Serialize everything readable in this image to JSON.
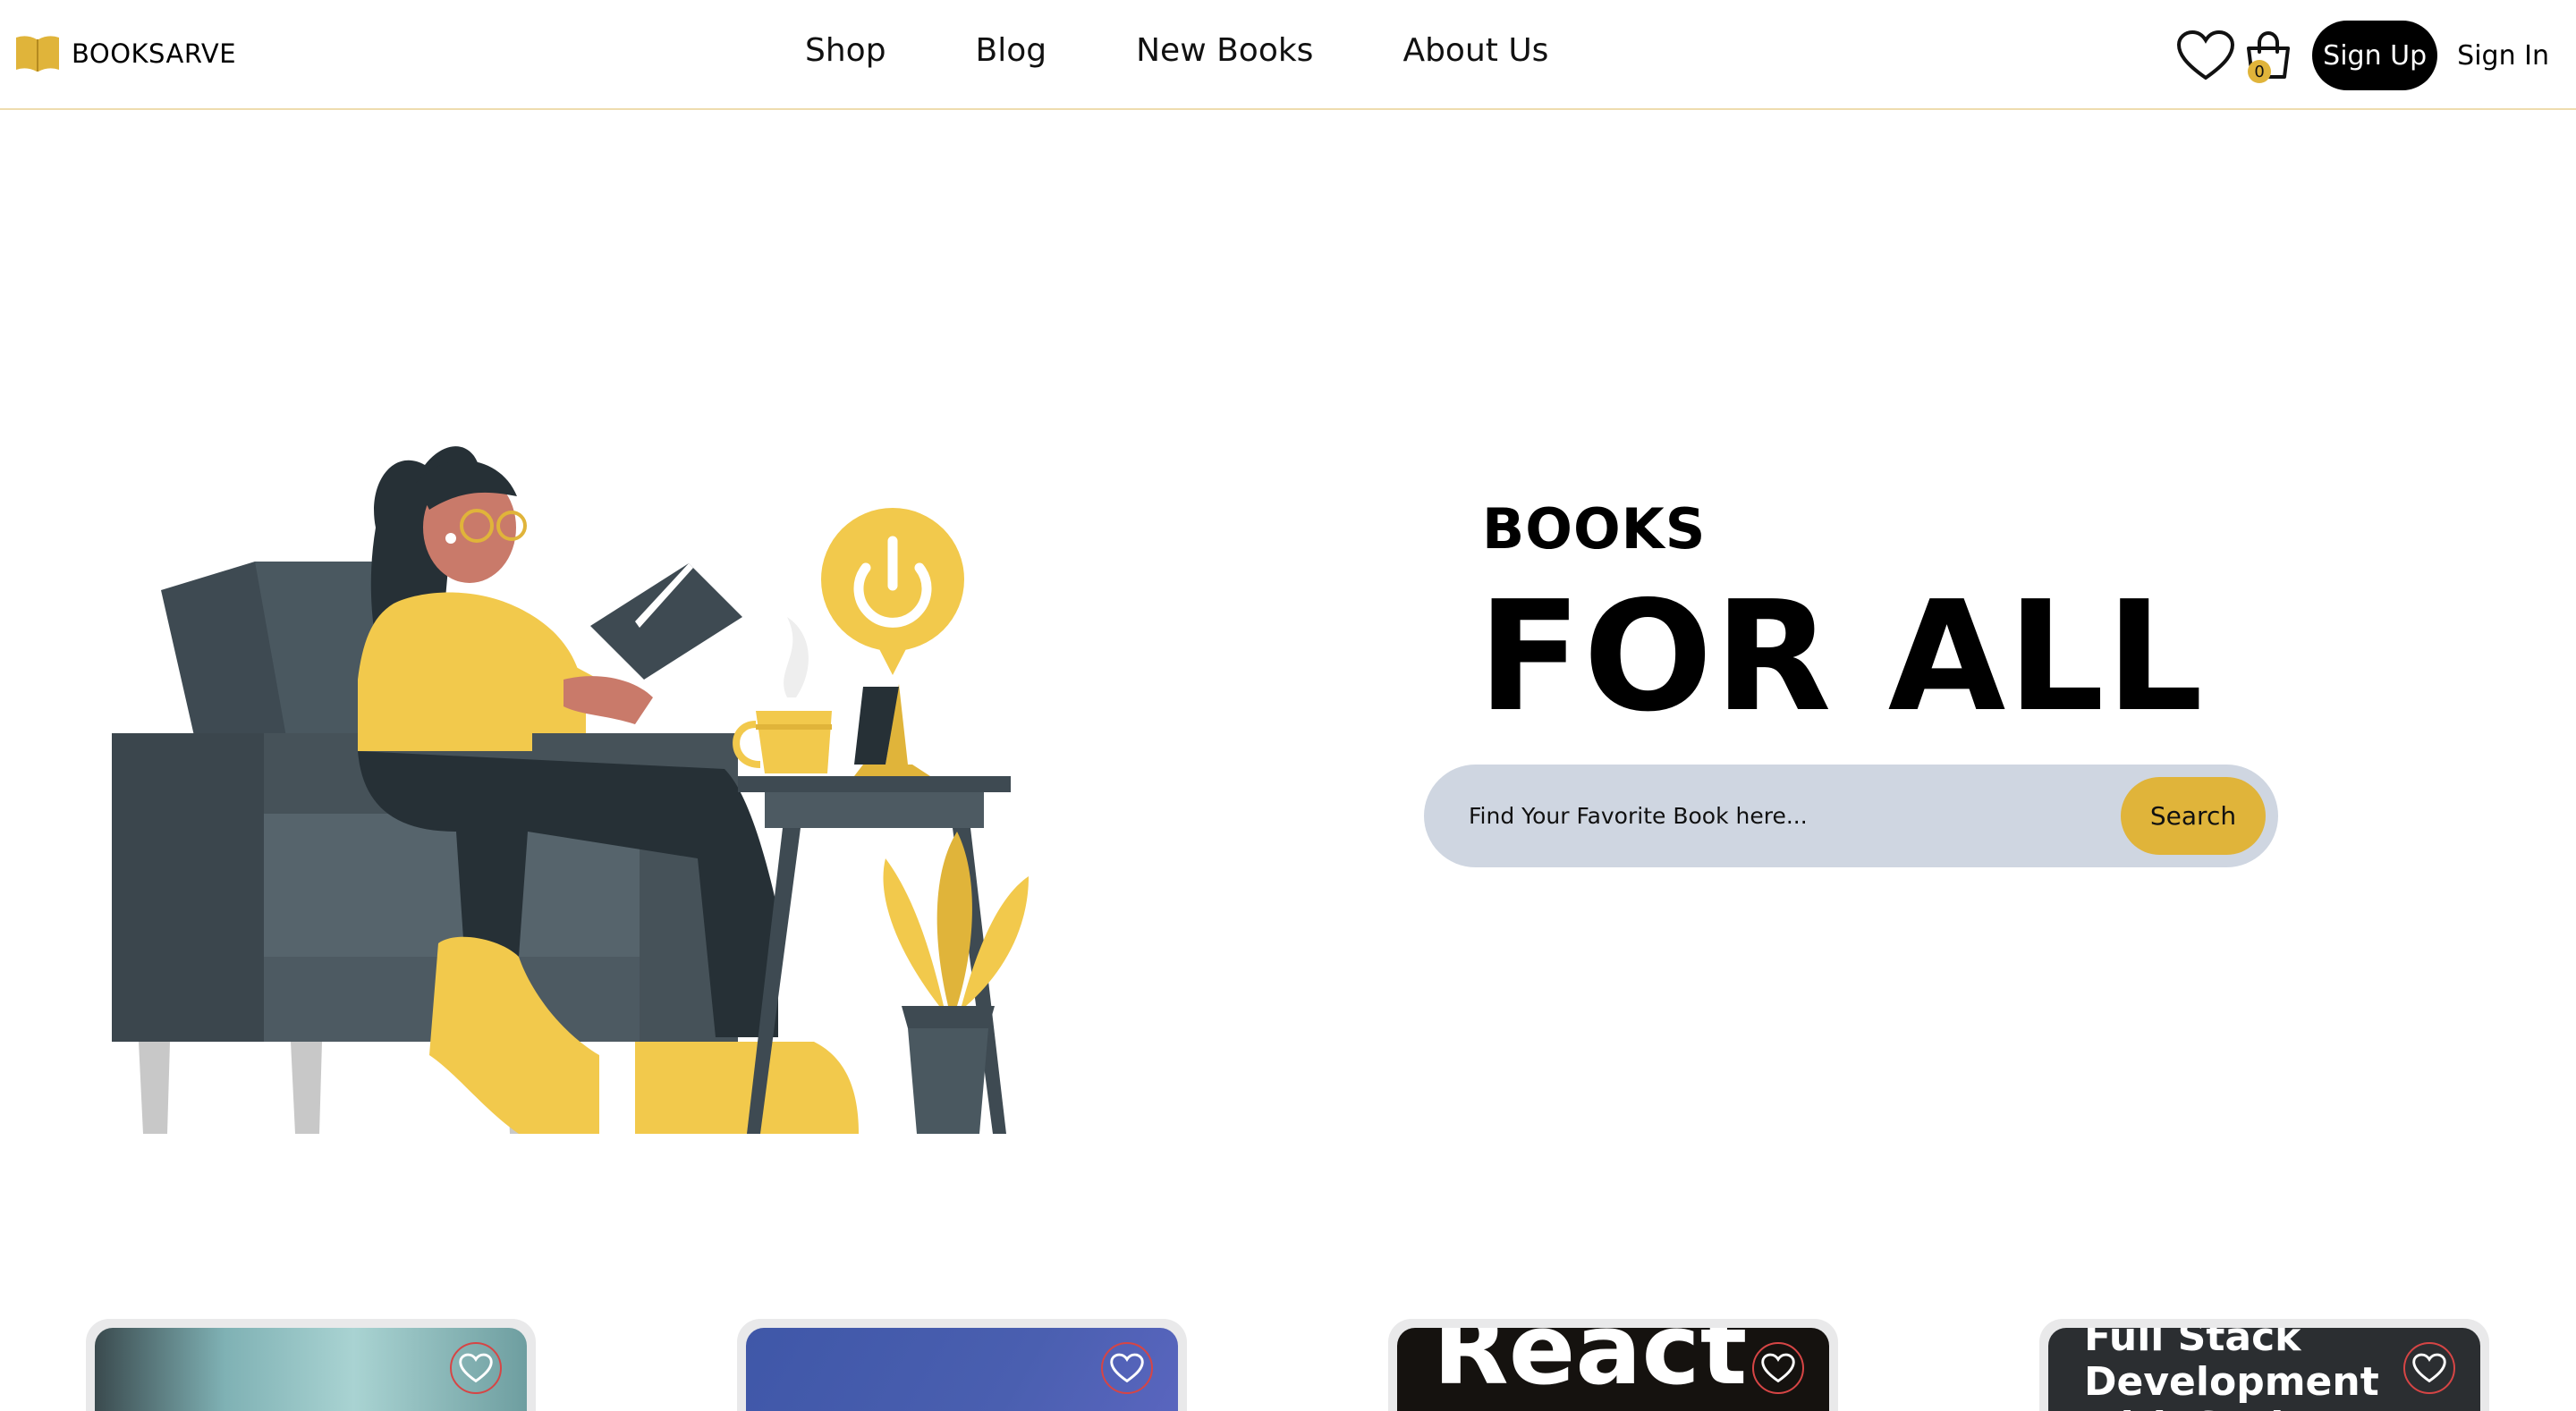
{
  "brand": {
    "name": "BOOKSARVE"
  },
  "nav": {
    "links": [
      "Shop",
      "Blog",
      "New Books",
      "About Us"
    ]
  },
  "header": {
    "cart_count": "0",
    "signup_label": "Sign Up",
    "signin_label": "Sign In"
  },
  "hero": {
    "subtitle": "BOOKS",
    "title": "FOR ALL",
    "search_placeholder": "Find Your Favorite Book here...",
    "search_button": "Search"
  },
  "books": [
    {
      "cover_text": ""
    },
    {
      "cover_text": ""
    },
    {
      "cover_text": "React"
    },
    {
      "cover_text": "Full Stack Development with Spring"
    }
  ],
  "colors": {
    "accent": "#e0b43a",
    "dark": "#000000",
    "search_bg": "#cfd6e1",
    "nav_border": "#eedcae"
  }
}
